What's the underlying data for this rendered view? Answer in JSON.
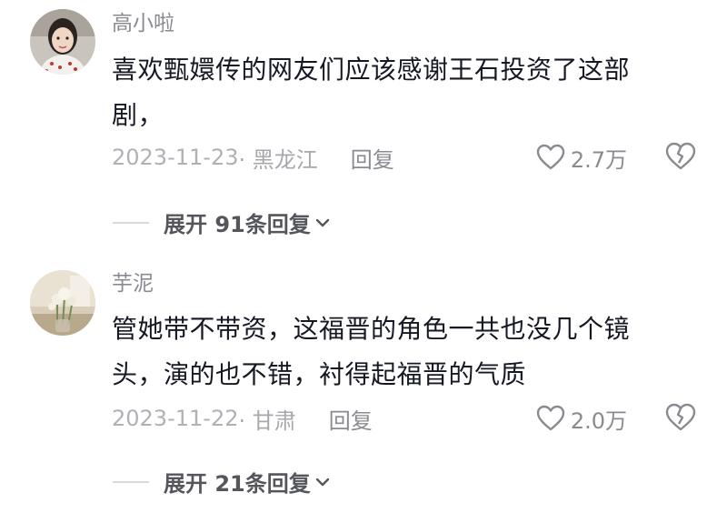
{
  "comments": [
    {
      "username": "高小啦",
      "text_lines": [
        "喜欢甄嬛传的网友们应该感谢王石投资了这部",
        "剧，"
      ],
      "date": "2023-11-23",
      "location": "· 黑龙江",
      "reply_label": "回复",
      "likes": "2.7万",
      "expand_label": "展开 91条回复",
      "avatar_icon": "user-avatar-woman"
    },
    {
      "username": "芋泥",
      "text_lines": [
        "管她带不带资，这福晋的角色一共也没几个镜",
        "头，演的也不错，衬得起福晋的气质"
      ],
      "date": "2023-11-22",
      "location": "· 甘肃",
      "reply_label": "回复",
      "likes": "2.0万",
      "expand_label": "展开 21条回复",
      "avatar_icon": "user-avatar-flowers"
    }
  ],
  "icons": {
    "like": "heart-outline-icon",
    "dislike": "broken-heart-icon",
    "expand": "chevron-down-icon"
  },
  "colors": {
    "text": "#161823",
    "secondary": "#8a8b91",
    "muted": "#a7a8ad"
  }
}
